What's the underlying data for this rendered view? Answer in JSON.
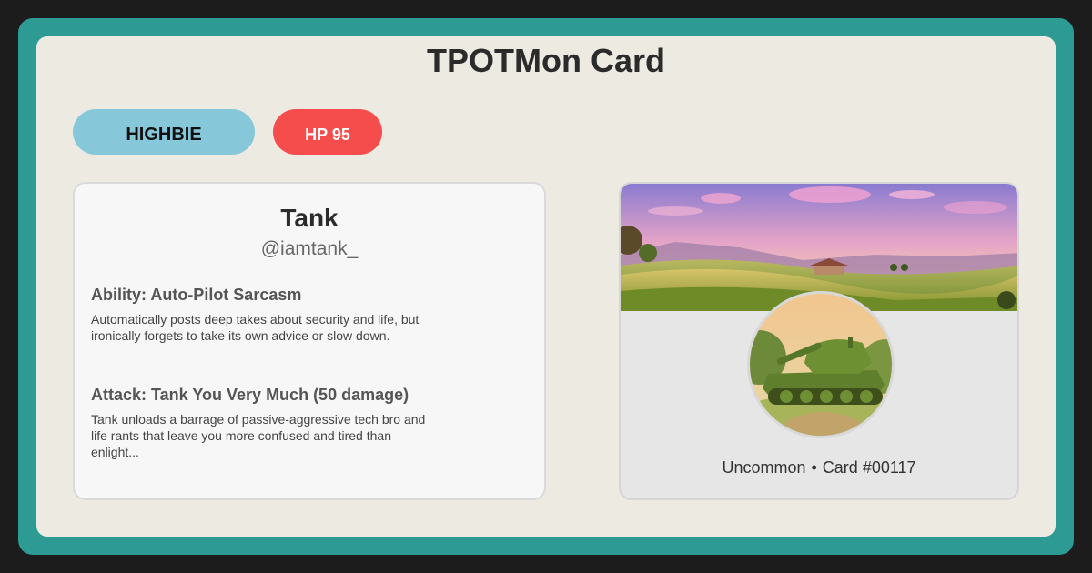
{
  "card_title": "TPOTMon Card",
  "badges": {
    "type_label": "HIGHBIE",
    "hp_label": "HP 95"
  },
  "profile": {
    "name": "Tank",
    "handle": "@iamtank_"
  },
  "ability": {
    "title": "Ability: Auto-Pilot Sarcasm",
    "description": "Automatically posts deep takes about security and life, but ironically forgets to take its own advice or slow down."
  },
  "attack": {
    "title": "Attack: Tank You Very Much (50 damage)",
    "description": "Tank unloads a barrage of passive-aggressive tech bro and life rants that leave you more confused and tired than enlight..."
  },
  "footer": {
    "rarity": "Uncommon",
    "separator": "•",
    "card_number": "Card #00117"
  },
  "colors": {
    "frame": "#2e9a94",
    "card_bg": "#edeae2",
    "type_badge": "#86c8da",
    "hp_badge": "#f44d4b"
  },
  "images": {
    "banner": "sunset-farmland-landscape",
    "avatar": "green-tank-avatar"
  }
}
